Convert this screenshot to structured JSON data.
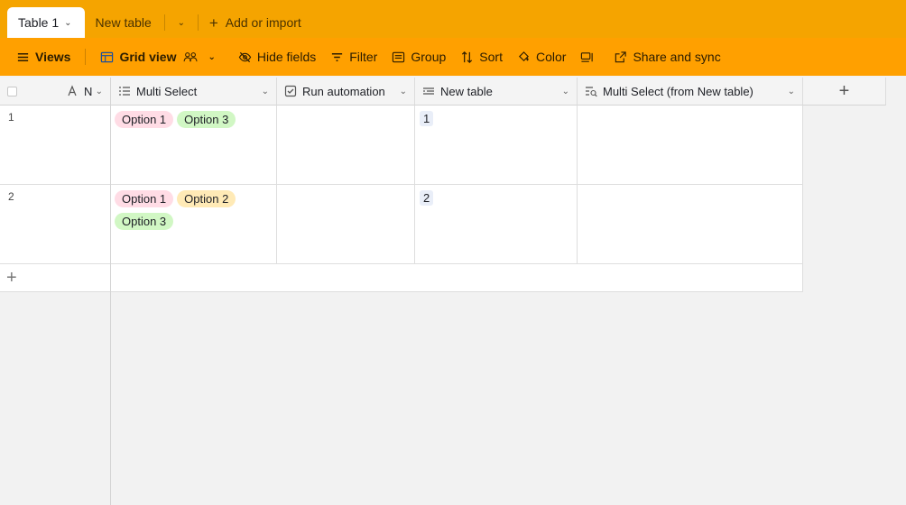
{
  "tabs": {
    "active": "Table 1",
    "second": "New table",
    "add_import": "Add or import"
  },
  "toolbar": {
    "views": "Views",
    "grid_view": "Grid view",
    "hide_fields": "Hide fields",
    "filter": "Filter",
    "group": "Group",
    "sort": "Sort",
    "color": "Color",
    "share_sync": "Share and sync"
  },
  "columns": {
    "name": "Na",
    "multi_select": "Multi Select",
    "run_automation": "Run automation",
    "new_table": "New table",
    "lookup": "Multi Select (from New table)"
  },
  "rows": [
    {
      "num": "1",
      "options": [
        {
          "label": "Option 1",
          "color": "pink"
        },
        {
          "label": "Option 3",
          "color": "green"
        }
      ],
      "link": "1"
    },
    {
      "num": "2",
      "options": [
        {
          "label": "Option 1",
          "color": "pink"
        },
        {
          "label": "Option 2",
          "color": "yellow"
        },
        {
          "label": "Option 3",
          "color": "green"
        }
      ],
      "link": "2"
    }
  ],
  "colors": {
    "tabbar": "#f5a400",
    "toolbar": "#ffa000",
    "pill_pink": "#ffdce5",
    "pill_green": "#d1f7c4",
    "pill_yellow": "#ffeab6"
  }
}
